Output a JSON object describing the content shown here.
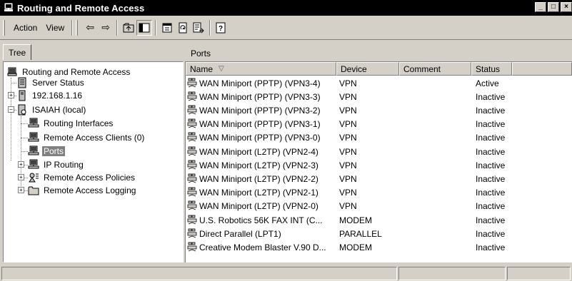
{
  "window": {
    "title": "Routing and Remote Access",
    "icon": "server-computer-icon"
  },
  "menu": {
    "action": "Action",
    "view": "View"
  },
  "toolbar": {
    "icons": [
      "back-arrow-icon",
      "forward-arrow-icon",
      "up-folder-icon",
      "show-tree-icon",
      "properties-icon",
      "refresh-icon",
      "export-list-icon",
      "help-icon"
    ]
  },
  "left": {
    "tab": "Tree"
  },
  "right": {
    "header": "Ports"
  },
  "tree": {
    "root": "Routing and Remote Access",
    "server_status": "Server Status",
    "server_ip": "192.168.1.16",
    "server_local": "ISAIAH (local)",
    "routing_interfaces": "Routing Interfaces",
    "remote_clients": "Remote Access Clients (0)",
    "ports": "Ports",
    "ip_routing": "IP Routing",
    "policies": "Remote Access Policies",
    "logging": "Remote Access Logging"
  },
  "table": {
    "columns": {
      "name": "Name",
      "device": "Device",
      "comment": "Comment",
      "status": "Status"
    },
    "sort_glyph": "▽",
    "rows": [
      {
        "name": "WAN Miniport (PPTP) (VPN3-4)",
        "device": "VPN",
        "comment": "",
        "status": "Active"
      },
      {
        "name": "WAN Miniport (PPTP) (VPN3-3)",
        "device": "VPN",
        "comment": "",
        "status": "Inactive"
      },
      {
        "name": "WAN Miniport (PPTP) (VPN3-2)",
        "device": "VPN",
        "comment": "",
        "status": "Inactive"
      },
      {
        "name": "WAN Miniport (PPTP) (VPN3-1)",
        "device": "VPN",
        "comment": "",
        "status": "Inactive"
      },
      {
        "name": "WAN Miniport (PPTP) (VPN3-0)",
        "device": "VPN",
        "comment": "",
        "status": "Inactive"
      },
      {
        "name": "WAN Miniport (L2TP) (VPN2-4)",
        "device": "VPN",
        "comment": "",
        "status": "Inactive"
      },
      {
        "name": "WAN Miniport (L2TP) (VPN2-3)",
        "device": "VPN",
        "comment": "",
        "status": "Inactive"
      },
      {
        "name": "WAN Miniport (L2TP) (VPN2-2)",
        "device": "VPN",
        "comment": "",
        "status": "Inactive"
      },
      {
        "name": "WAN Miniport (L2TP) (VPN2-1)",
        "device": "VPN",
        "comment": "",
        "status": "Inactive"
      },
      {
        "name": "WAN Miniport (L2TP) (VPN2-0)",
        "device": "VPN",
        "comment": "",
        "status": "Inactive"
      },
      {
        "name": "U.S. Robotics 56K FAX INT (C...",
        "device": "MODEM",
        "comment": "",
        "status": "Inactive"
      },
      {
        "name": "Direct Parallel (LPT1)",
        "device": "PARALLEL",
        "comment": "",
        "status": "Inactive"
      },
      {
        "name": "Creative Modem Blaster V.90 D...",
        "device": "MODEM",
        "comment": "",
        "status": "Inactive"
      }
    ]
  },
  "colors": {
    "titlebar": "#000000",
    "chrome": "#d4d0c8",
    "selection": "#808080"
  }
}
